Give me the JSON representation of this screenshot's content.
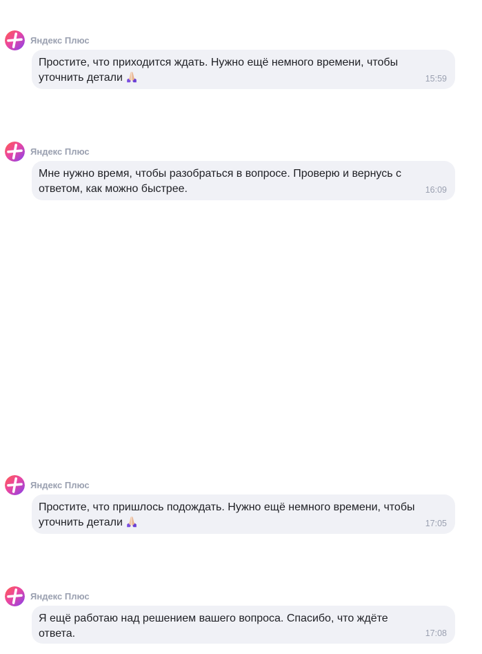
{
  "messages": [
    {
      "sender": "Яндекс Плюс",
      "text": "Простите, что приходится ждать. Нужно ещё немного времени, чтобы уточнить детали",
      "emoji": "🙏",
      "time": "15:59"
    },
    {
      "sender": "Яндекс Плюс",
      "text": "Мне нужно время, чтобы разобраться в вопросе. Проверю и вернусь с ответом, как можно быстрее.",
      "time": "16:09"
    },
    {
      "sender": "Яндекс Плюс",
      "text": "Простите, что пришлось подождать. Нужно ещё немного времени, чтобы уточнить детали",
      "emoji": "🙏",
      "time": "17:05"
    },
    {
      "sender": "Яндекс Плюс",
      "text": "Я ещё работаю над решением вашего вопроса. Спасибо, что ждёте ответа.",
      "time": "17:08"
    }
  ],
  "icons": {
    "avatar": "yandex-plus-logo-icon",
    "emoji": "praying-hands-icon"
  },
  "colors": {
    "bubble_bg": "#f0f1f6",
    "meta_text": "#9aa0b0",
    "message_text": "#1e1f24",
    "logo_gradient": [
      "#ff5c4d",
      "#eb469f",
      "#8341ef"
    ]
  }
}
